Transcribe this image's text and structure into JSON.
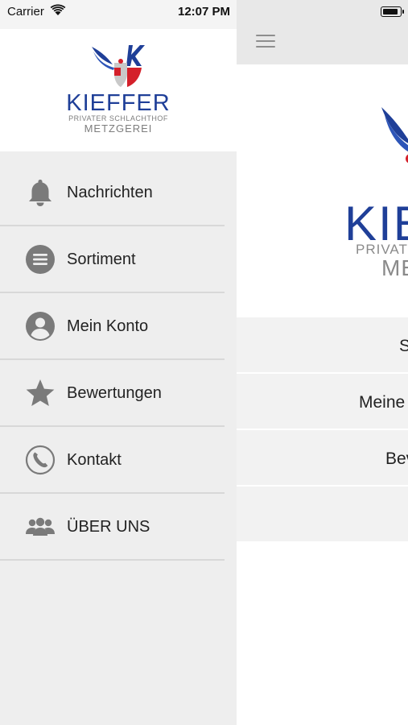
{
  "status_bar": {
    "carrier": "Carrier",
    "time": "12:07 PM"
  },
  "logo": {
    "name": "KIEFFER",
    "subtitle": "PRIVATER SCHLACHTHOF",
    "tagline": "METZGEREI"
  },
  "menu": {
    "items": [
      {
        "label": "Nachrichten",
        "icon": "bell-icon"
      },
      {
        "label": "Sortiment",
        "icon": "list-icon"
      },
      {
        "label": "Mein Konto",
        "icon": "user-icon"
      },
      {
        "label": "Bewertungen",
        "icon": "star-icon"
      },
      {
        "label": "Kontakt",
        "icon": "phone-icon"
      },
      {
        "label": "ÜBER UNS",
        "icon": "group-icon"
      }
    ]
  },
  "main": {
    "logo_partial": {
      "name": "KIEF",
      "subtitle": "PRIVATE",
      "tagline": "ME"
    },
    "rows": [
      "S",
      "Meine",
      "Bev",
      ""
    ]
  },
  "colors": {
    "brand_blue": "#1f3f98",
    "brand_red": "#d4202a",
    "icon_gray": "#7a7a7a",
    "drawer_bg": "#eeeeee"
  }
}
